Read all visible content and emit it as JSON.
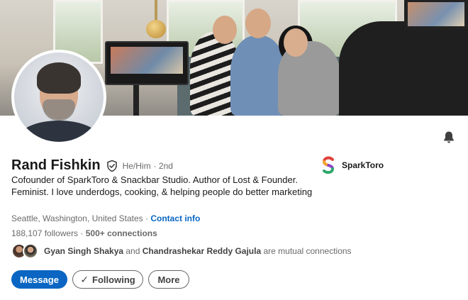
{
  "profile": {
    "name": "Rand Fishkin",
    "pronouns": "He/Him",
    "degree": "· 2nd",
    "headline": "Cofounder of SparkToro & Snackbar Studio. Author of Lost & Founder. Feminist. I love underdogs, cooking, & helping people do better marketing",
    "location": "Seattle, Washington, United States",
    "location_separator": " · ",
    "contact_info_label": "Contact info",
    "followers": "188,107 followers",
    "connections_sep": " · ",
    "connections": "500+ connections"
  },
  "mutual": {
    "name1": "Gyan Singh Shakya",
    "and_text": " and ",
    "name2": "Chandrashekar Reddy Gajula",
    "suffix": " are mutual connections"
  },
  "actions": {
    "message_label": "Message",
    "following_label": "Following",
    "more_label": "More"
  },
  "company": {
    "name": "SparkToro",
    "logo_icon": "sparktoro-logo-icon"
  },
  "icons": {
    "bell": "bell-icon",
    "verified": "verified-shield-icon",
    "check": "✓"
  },
  "colors": {
    "accent": "#0a66c2",
    "text_primary": "rgba(0,0,0,0.9)",
    "text_secondary": "rgba(0,0,0,0.6)"
  }
}
